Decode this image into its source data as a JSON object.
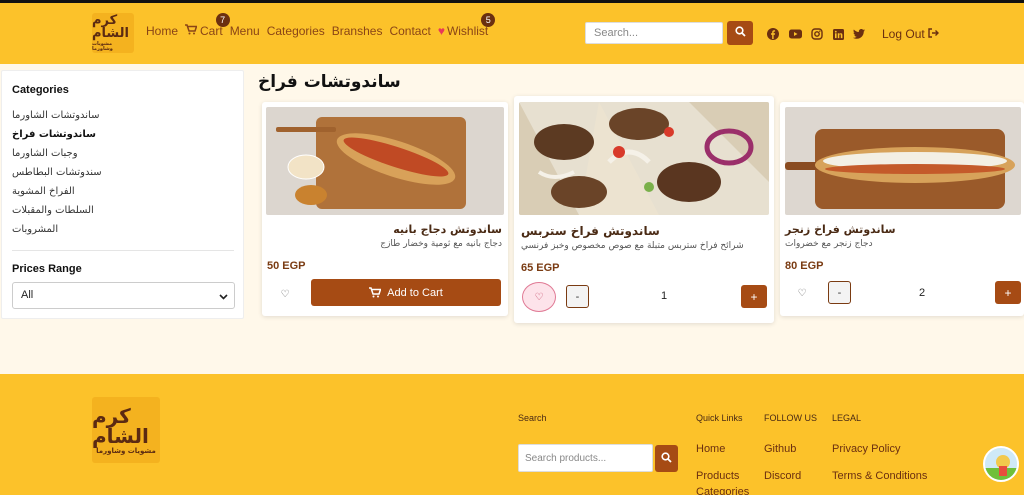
{
  "header": {
    "logo_text": "كرم الشام",
    "logo_subtext": "مشويات وشاورما",
    "nav": [
      {
        "label": "Home"
      },
      {
        "label": "Cart",
        "badge": "7"
      },
      {
        "label": "Menu"
      },
      {
        "label": "Categories"
      },
      {
        "label": "Branshes"
      },
      {
        "label": "Contact"
      },
      {
        "label": "Wishlist",
        "badge": "5"
      }
    ],
    "search_placeholder": "Search...",
    "social_icons": [
      "facebook-icon",
      "youtube-icon",
      "instagram-icon",
      "linkedin-icon",
      "twitter-icon"
    ],
    "logout_label": "Log Out"
  },
  "sidebar": {
    "categories_title": "Categories",
    "categories": [
      "ساندوتشات الشاورما",
      "ساندوتشات فراخ",
      "وجبات الشاورما",
      "سندوتشات البطاطس",
      "الفراخ المشوية",
      "السلطات والمقبلات",
      "المشروبات"
    ],
    "active_category": "ساندوتشات فراخ",
    "price_title": "Prices Range",
    "price_selected": "All"
  },
  "main": {
    "section_title": "ساندوتشات فراخ",
    "products": [
      {
        "name": "ساندوتش دجاج بانيه",
        "desc": "دجاج بانيه مع ثومية وخضار طازج",
        "price": "50 EGP",
        "action": "Add to Cart"
      },
      {
        "name": "ساندوتش فراخ ستربس",
        "desc": "شرائح فراخ ستربس متبلة مع صوص مخصوص وخبز فرنسي",
        "price": "65 EGP",
        "qty": "1",
        "minus": "-",
        "plus": "+"
      },
      {
        "name": "ساندوتش فراخ زنجر",
        "desc": "دجاج زنجر مع خضروات",
        "price": "80 EGP",
        "qty": "2",
        "minus": "-",
        "plus": "+"
      }
    ]
  },
  "footer": {
    "logo_text": "كرم الشام",
    "logo_subtext": "مشويات وشاورما",
    "search_title": "Search",
    "search_placeholder": "Search products...",
    "quick_links_title": "Quick Links",
    "quick_links": [
      "Home",
      "Products",
      "Categories"
    ],
    "follow_title": "FOLLOW US",
    "follow_links": [
      "Github",
      "Discord"
    ],
    "legal_title": "LEGAL",
    "legal_links": [
      "Privacy Policy",
      "Terms & Conditions"
    ]
  },
  "colors": {
    "header_bg": "#fcc22a",
    "accent": "#a64b14",
    "page_bg": "#fff8ea",
    "wishlist_heart": "#e8385a"
  }
}
